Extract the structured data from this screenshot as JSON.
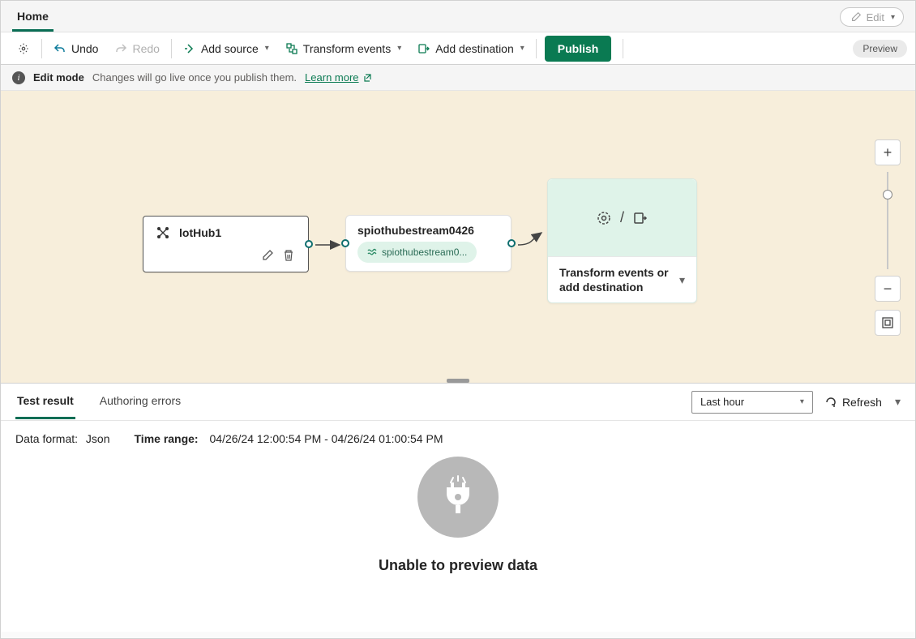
{
  "menubar": {
    "home": "Home",
    "edit": "Edit"
  },
  "toolbar": {
    "undo": "Undo",
    "redo": "Redo",
    "add_source": "Add source",
    "transform": "Transform events",
    "add_dest": "Add destination",
    "publish": "Publish",
    "preview": "Preview"
  },
  "infobar": {
    "mode": "Edit mode",
    "msg": "Changes will go live once you publish them.",
    "learn": "Learn more"
  },
  "nodes": {
    "a": {
      "title": "lotHub1"
    },
    "b": {
      "title": "spiothubestream0426",
      "chip": "spiothubestream0..."
    },
    "c": {
      "label": "Transform events or add destination"
    }
  },
  "bottom": {
    "tabs": {
      "test": "Test result",
      "errors": "Authoring errors"
    },
    "range_sel": "Last hour",
    "refresh": "Refresh",
    "format_label": "Data format:",
    "format_val": "Json",
    "time_label": "Time range:",
    "time_val": "04/26/24 12:00:54 PM - 04/26/24 01:00:54 PM",
    "empty": "Unable to preview data"
  }
}
